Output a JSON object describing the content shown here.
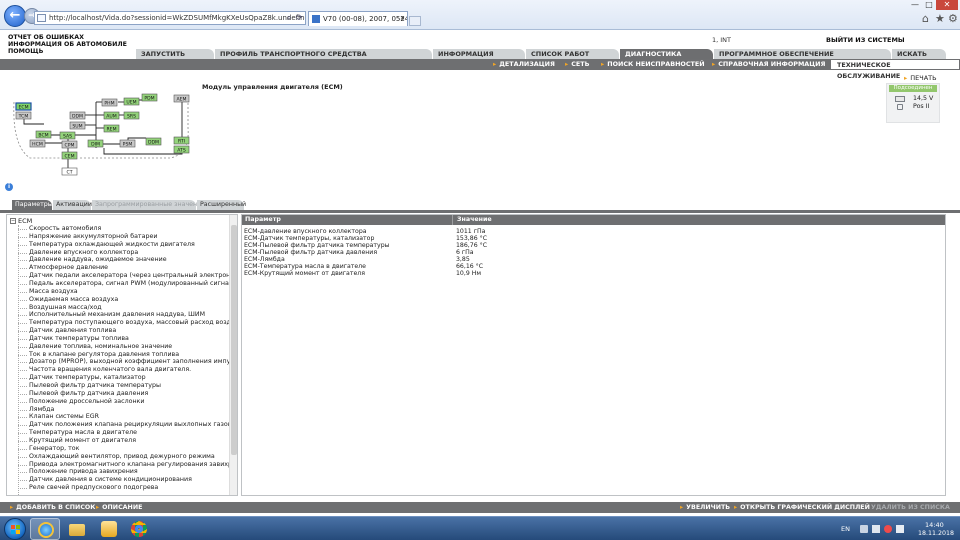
{
  "browser": {
    "address": "http://localhost/Vida.do?sessionid=WkZDSUMfMkgKXeUsQpaZ8k.undefined",
    "tab_title": "V70 (00-08), 2007, 0524474, ...",
    "search_glyph": "⌕",
    "refresh_glyph": "⟳",
    "close_glyph": "✕",
    "home_glyph": "⌂",
    "star_glyph": "★",
    "gear_glyph": "⚙",
    "back_glyph": "←",
    "forward_glyph": "→",
    "win_min": "—",
    "win_max": "□",
    "win_close": "✕"
  },
  "header": {
    "title_lines": [
      "ОТЧЕТ ОБ ОШИБКАХ",
      "ИНФОРМАЦИЯ ОБ АВТОМОБИЛЕ",
      "ПОМОЩЬ"
    ],
    "user_code": "1, INT",
    "logout": "ВЫЙТИ ИЗ СИСТЕМЫ"
  },
  "main_tabs": [
    "ЗАПУСТИТЬ",
    "ПРОФИЛЬ ТРАНСПОРТНОГО СРЕДСТВА",
    "ИНФОРМАЦИЯ",
    "СПИСОК РАБОТ",
    "ДИАГНОСТИКА",
    "ПРОГРАММНОЕ ОБЕСПЕЧЕНИЕ",
    "ИСКАТЬ"
  ],
  "active_main_tab": "ДИАГНОСТИКА",
  "sub_tabs": [
    "ДЕТАЛИЗАЦИЯ",
    "СЕТЬ",
    "ПОИСК НЕИСПРАВНОСТЕЙ",
    "СПРАВОЧНАЯ ИНФОРМАЦИЯ",
    "ТЕХНИЧЕСКОЕ ОБСЛУЖИВАНИЕ"
  ],
  "active_sub_tab": "ТЕХНИЧЕСКОЕ ОБСЛУЖИВАНИЕ",
  "print_label": "ПЕЧАТЬ",
  "module_title": "Модуль управления двигателя (ECM)",
  "connection": {
    "badge": "Подсоединен",
    "voltage": "14,5 V",
    "position": "Pos II"
  },
  "network_nodes": [
    {
      "label": "ECM",
      "status": "selected"
    },
    {
      "label": "TCM",
      "status": "grey"
    },
    {
      "label": "PHM",
      "status": "grey"
    },
    {
      "label": "PDM",
      "status": "green"
    },
    {
      "label": "UEM",
      "status": "green"
    },
    {
      "label": "AEM",
      "status": "grey"
    },
    {
      "label": "DDM",
      "status": "grey"
    },
    {
      "label": "AUM",
      "status": "green"
    },
    {
      "label": "SRS",
      "status": "green"
    },
    {
      "label": "SUM",
      "status": "grey"
    },
    {
      "label": "REM",
      "status": "green"
    },
    {
      "label": "BCM",
      "status": "green"
    },
    {
      "label": "SAS",
      "status": "green"
    },
    {
      "label": "HCM",
      "status": "grey"
    },
    {
      "label": "CPM",
      "status": "grey"
    },
    {
      "label": "DIM",
      "status": "green"
    },
    {
      "label": "PSM",
      "status": "grey"
    },
    {
      "label": "DDM",
      "status": "green"
    },
    {
      "label": "RTI",
      "status": "green"
    },
    {
      "label": "ATS",
      "status": "green"
    },
    {
      "label": "CEM",
      "status": "green"
    },
    {
      "label": "CT",
      "status": "white"
    }
  ],
  "info_glyph": "i",
  "section_tabs": [
    "Параметры",
    "Активации",
    "Запрограммированные значения",
    "Расширенный"
  ],
  "active_section_tab": "Параметры",
  "tree": {
    "root_toggle": "−",
    "root": "ECM",
    "items": [
      "Скорость автомобиля",
      "Напряжение аккумуляторной батареи",
      "Температура охлаждающей жидкости двигателя",
      "Давление впускного коллектора",
      "Давление наддува, ожидаемое значение",
      "Атмосферное давление",
      "Датчик педали акселератора (через центральный электронный мо",
      "Педаль акселератора, сигнал PWM (модулированный сигнал коэфф",
      "Масса воздуха",
      "Ожидаемая масса воздуха",
      "Воздушная масса/ход",
      "Исполнительный механизм давления наддува, ШИМ",
      "Температура поступающего воздуха, массовый расход воздуха",
      "Датчик давления топлива",
      "Датчик температуры топлива",
      "Давление топлива, номинальное значение",
      "Ток в клапане регулятора давления топлива",
      "Дозатор (MPROP), выходной коэффициент заполнения импульса",
      "Частота вращения коленчатого вала двигателя.",
      "Датчик температуры, катализатор",
      "Пылевой фильтр датчика температуры",
      "Пылевой фильтр датчика давления",
      "Положение дроссельной заслонки",
      "Лямбда",
      "Клапан системы EGR",
      "Датчик положения клапана рециркуляции выхлопных газов (EGR)",
      "Температура масла в двигателе",
      "Крутящий момент от двигателя",
      "Генератор, ток",
      "Охлаждающий вентилятор, привод дежурного режима",
      "Привода электромагнитного клапана регулирования завихрений, U",
      "Положение привода завихрения",
      "Датчик давления в системе кондиционирования",
      "Реле свечей предпускового подогрева"
    ]
  },
  "values_table": {
    "headers": [
      "Параметр",
      "Значение"
    ],
    "rows": [
      {
        "name": "ECM-давление впускного коллектора",
        "value": "1011 гПа"
      },
      {
        "name": "ECM-Датчик температуры, катализатор",
        "value": "153,86 °C"
      },
      {
        "name": "ECM-Пылевой фильтр датчика температуры",
        "value": "186,76 °C"
      },
      {
        "name": "ECM-Пылевой фильтр датчика давления",
        "value": "6 гПа"
      },
      {
        "name": "ECM-Лямбда",
        "value": "3,85"
      },
      {
        "name": "ECM-Температура масла в двигателе",
        "value": "66,16 °C"
      },
      {
        "name": "ECM-Крутящий момент от двигателя",
        "value": "10,9 Нм"
      }
    ]
  },
  "actions": {
    "add": "ДОБАВИТЬ В СПИСОК",
    "description": "ОПИСАНИЕ",
    "zoom": "УВЕЛИЧИТЬ",
    "graph": "ОТКРЫТЬ ГРАФИЧЕСКИЙ ДИСПЛЕЙ",
    "remove": "УДАЛИТЬ ИЗ СПИСКА"
  },
  "taskbar": {
    "lang": "EN",
    "time": "14:40",
    "date": "18.11.2018"
  },
  "colors": {
    "accent_orange": "#f1a526",
    "bar_grey": "#6e6f71",
    "node_green": "#93d37a",
    "node_grey": "#c8c8c8"
  }
}
